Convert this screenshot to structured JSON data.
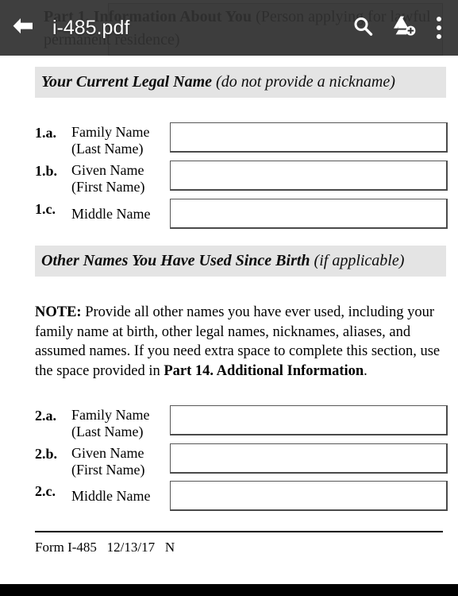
{
  "toolbar": {
    "filename": "i-485.pdf",
    "back_icon": "back-arrow-icon",
    "search_icon": "search-icon",
    "drive_icon": "add-to-drive-icon",
    "overflow_icon": "more-options-icon",
    "background_color": "#303030"
  },
  "document": {
    "part_header": {
      "bold_text": "Part 1.  Information About You",
      "paren_text": " (Person applying for lawful permanent residence)"
    },
    "sections": [
      {
        "id": "current-legal-name",
        "heading_strong": "Your Current Legal Name",
        "heading_paren": " (do not provide a nickname)",
        "band_color": "#e4e4e4",
        "rows": [
          {
            "number": "1.a.",
            "label_line1": "Family Name",
            "label_line2": "(Last Name)",
            "value": "",
            "placeholder": ""
          },
          {
            "number": "1.b.",
            "label_line1": "Given Name",
            "label_line2": "(First Name)",
            "value": "",
            "placeholder": ""
          },
          {
            "number": "1.c.",
            "label_line1": "Middle Name",
            "label_line2": "",
            "value": "",
            "placeholder": ""
          }
        ]
      },
      {
        "id": "other-names-used",
        "heading_strong": "Other Names You Have Used Since Birth",
        "heading_paren": " (if applicable)",
        "band_color": "#e4e4e4",
        "note": {
          "label": "NOTE:",
          "body_part1": "  Provide all other names you have ever used, including your family name at birth, other legal names, nicknames, aliases, and assumed names.  If you need extra space to complete this section, use the space provided in ",
          "bold_ref": "Part 14. Additional Information",
          "body_part2": "."
        },
        "rows": [
          {
            "number": "2.a.",
            "label_line1": "Family Name",
            "label_line2": "(Last Name)",
            "value": "",
            "placeholder": ""
          },
          {
            "number": "2.b.",
            "label_line1": "Given Name",
            "label_line2": "(First Name)",
            "value": "",
            "placeholder": ""
          },
          {
            "number": "2.c.",
            "label_line1": "Middle Name",
            "label_line2": "",
            "value": "",
            "placeholder": ""
          }
        ]
      }
    ],
    "footer": "Form I-485   12/13/17   N"
  }
}
